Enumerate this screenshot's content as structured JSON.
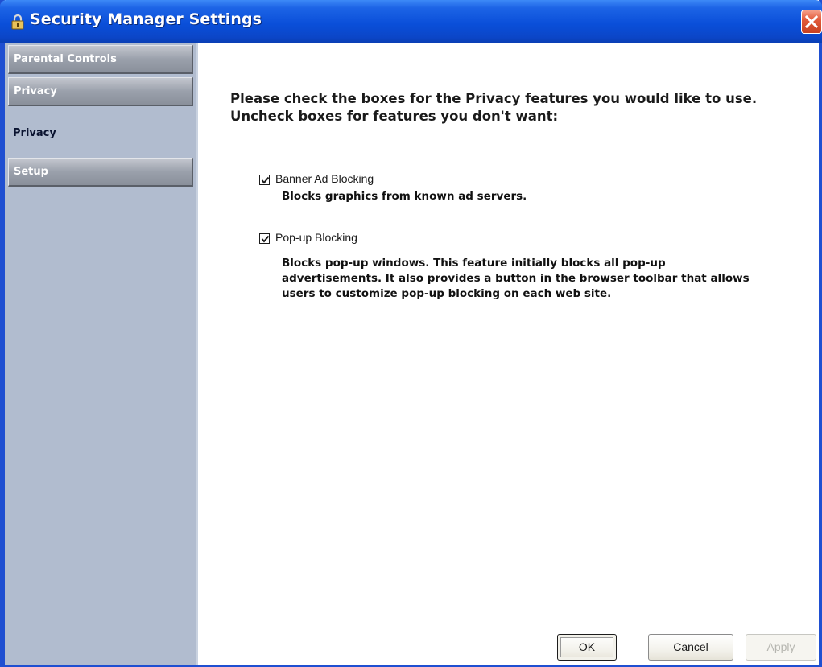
{
  "window": {
    "title": "Security Manager Settings",
    "close_icon": "close-x-icon",
    "title_icon": "padlock-icon"
  },
  "sidebar": {
    "items": [
      {
        "label": "Parental Controls"
      },
      {
        "label": "Privacy",
        "selected": true
      },
      {
        "label": "Privacy",
        "type": "subitem"
      },
      {
        "label": "Setup"
      }
    ]
  },
  "content": {
    "instructions": "Please check the boxes for the Privacy features you would like to use. Uncheck boxes for features you don't want:",
    "options": [
      {
        "label": "Banner Ad Blocking",
        "checked": true,
        "description": "Blocks graphics from known ad servers."
      },
      {
        "label": "Pop-up Blocking",
        "checked": true,
        "description": "Blocks pop-up windows. This feature initially blocks all pop-up advertisements.  It also provides a button in the browser toolbar that allows users to customize pop-up blocking on each web site."
      }
    ]
  },
  "buttons": {
    "ok": "OK",
    "cancel": "Cancel",
    "apply": "Apply",
    "apply_enabled": false
  },
  "colors": {
    "titlebar": "#0a4fd9",
    "sidebar": "#b1bccf",
    "nav_button": "#9aa0ab",
    "close_button": "#e25a3a"
  }
}
